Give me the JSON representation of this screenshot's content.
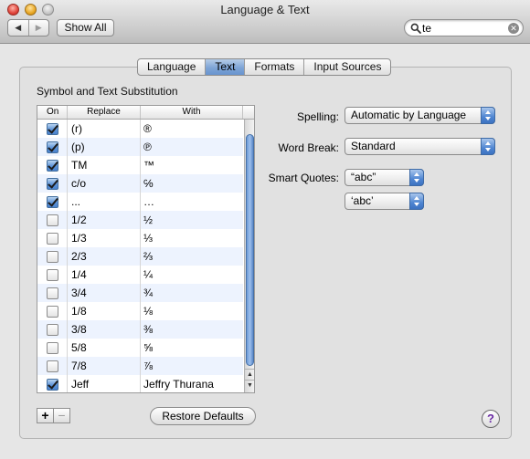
{
  "window": {
    "title": "Language & Text"
  },
  "toolbar": {
    "back_glyph": "◀",
    "forward_glyph": "▶",
    "show_all_label": "Show All"
  },
  "search": {
    "value": "te",
    "clear_glyph": "✕"
  },
  "tabs": [
    {
      "label": "Language",
      "active": false
    },
    {
      "label": "Text",
      "active": true
    },
    {
      "label": "Formats",
      "active": false
    },
    {
      "label": "Input Sources",
      "active": false
    }
  ],
  "substitution": {
    "title": "Symbol and Text Substitution",
    "columns": {
      "on": "On",
      "replace": "Replace",
      "with": "With"
    },
    "rows": [
      {
        "on": true,
        "replace": "(r)",
        "with": "®"
      },
      {
        "on": true,
        "replace": "(p)",
        "with": "℗"
      },
      {
        "on": true,
        "replace": "TM",
        "with": "™"
      },
      {
        "on": true,
        "replace": "c/o",
        "with": "℅"
      },
      {
        "on": true,
        "replace": "...",
        "with": "…"
      },
      {
        "on": false,
        "replace": "1/2",
        "with": "½"
      },
      {
        "on": false,
        "replace": "1/3",
        "with": "⅓"
      },
      {
        "on": false,
        "replace": "2/3",
        "with": "⅔"
      },
      {
        "on": false,
        "replace": "1/4",
        "with": "¼"
      },
      {
        "on": false,
        "replace": "3/4",
        "with": "¾"
      },
      {
        "on": false,
        "replace": "1/8",
        "with": "⅛"
      },
      {
        "on": false,
        "replace": "3/8",
        "with": "⅜"
      },
      {
        "on": false,
        "replace": "5/8",
        "with": "⅝"
      },
      {
        "on": false,
        "replace": "7/8",
        "with": "⅞"
      },
      {
        "on": true,
        "replace": "Jeff",
        "with": "Jeffry Thurana"
      }
    ],
    "add_label": "+",
    "remove_label": "−",
    "restore_label": "Restore Defaults"
  },
  "settings": {
    "spelling_label": "Spelling:",
    "spelling_value": "Automatic by Language",
    "word_break_label": "Word Break:",
    "word_break_value": "Standard",
    "smart_quotes_label": "Smart Quotes:",
    "double_quotes_value": "“abc”",
    "single_quotes_value": "‘abc’"
  },
  "help": {
    "label": "?"
  },
  "colors": {
    "accent": "#5d93d8",
    "row_alt": "#edf3fe",
    "help_glyph": "#6a2aa4"
  }
}
